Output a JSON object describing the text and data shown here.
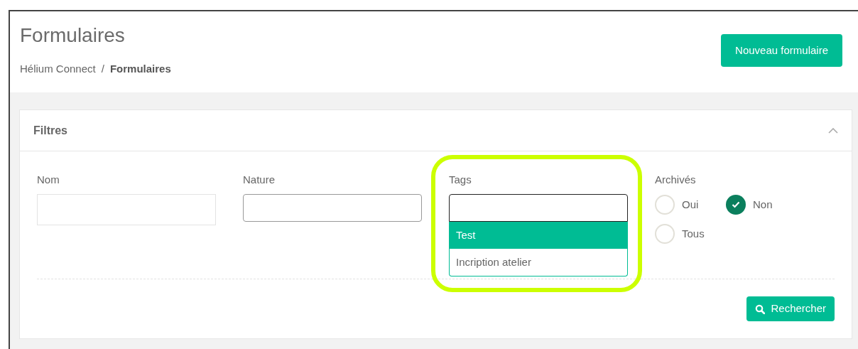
{
  "page": {
    "title": "Formulaires",
    "breadcrumb": [
      {
        "label": "Hélium Connect",
        "current": false
      },
      {
        "label": "Formulaires",
        "current": true
      }
    ],
    "breadcrumb_separator": "/",
    "new_button": "Nouveau formulaire"
  },
  "filters": {
    "title": "Filtres",
    "expanded": true,
    "fields": [
      {
        "kind": "text",
        "label": "Nom",
        "hovered": false
      },
      {
        "kind": "text",
        "label": "Nature",
        "hovered": true
      },
      {
        "kind": "dropdown",
        "label": "Tags",
        "highlighted": true,
        "options": [
          {
            "label": "Test",
            "selected": true
          },
          {
            "label": "Incription atelier",
            "selected": false
          }
        ]
      },
      {
        "kind": "radio",
        "label": "Archivés",
        "options": [
          {
            "label": "Oui",
            "selected": false
          },
          {
            "label": "Non",
            "selected": true
          },
          {
            "label": "Tous",
            "selected": false
          }
        ]
      }
    ],
    "search_button": "Rechercher"
  }
}
